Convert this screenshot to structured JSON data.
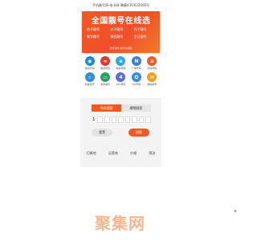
{
  "topbar": {
    "text": "手机靓号网-电卡网-豫备ICP2022006号"
  },
  "banner": {
    "title": "全国靓号在线选",
    "items": [
      "豹子靓号",
      "对子靓号",
      "托子靓号",
      "尾号靓号",
      "情侣靓号",
      "生日靓号"
    ],
    "footer": "选号靓号·靓号在线选"
  },
  "icons": [
    {
      "label": "移动号码",
      "icon": "china-mobile-icon",
      "color": "#1a8bd6",
      "glyph": "◉"
    },
    {
      "label": "联通号码",
      "icon": "china-unicom-icon",
      "color": "#e03a2f",
      "glyph": "∞"
    },
    {
      "label": "电信号码",
      "icon": "china-telecom-icon",
      "color": "#2fa7e0",
      "glyph": "e"
    },
    {
      "label": "广电号码",
      "icon": "broadcast-icon",
      "color": "#3a7fd8",
      "glyph": "N"
    },
    {
      "label": "同城号码",
      "icon": "city-icon",
      "color": "#f05a22",
      "glyph": "≡"
    },
    {
      "label": "新星靓号",
      "icon": "star-icon",
      "color": "#2d8fe0",
      "glyph": "☆"
    },
    {
      "label": "车牌靓号",
      "icon": "car-plate-icon",
      "color": "#2aa060",
      "glyph": "▭"
    },
    {
      "label": "400号码",
      "icon": "hotline-icon",
      "color": "#5b6fd6",
      "glyph": "4"
    },
    {
      "label": "QQ号码",
      "icon": "qq-icon",
      "color": "#2f8fe0",
      "glyph": "Q"
    },
    {
      "label": "微信靓号",
      "icon": "wechat-icon",
      "color": "#f0a020",
      "glyph": "✉"
    }
  ],
  "search": {
    "tab_active": "号码搜索",
    "tab_inactive": "模糊搜索",
    "first_digit": "1",
    "reset_label": "重置",
    "search_label": "搜索"
  },
  "filters": [
    "归属地",
    "运营商",
    "价格",
    "筛选"
  ],
  "brand": {
    "logo_text": "聚集网"
  }
}
